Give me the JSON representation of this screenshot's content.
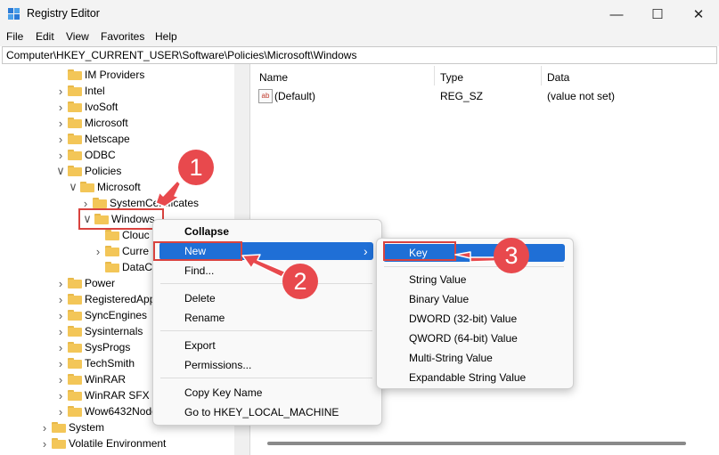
{
  "window": {
    "title": "Registry Editor"
  },
  "menu": [
    "File",
    "Edit",
    "View",
    "Favorites",
    "Help"
  ],
  "address": "Computer\\HKEY_CURRENT_USER\\Software\\Policies\\Microsoft\\Windows",
  "tree": [
    {
      "label": "IM Providers",
      "chev": ""
    },
    {
      "label": "Intel",
      "chev": ">"
    },
    {
      "label": "IvoSoft",
      "chev": ">"
    },
    {
      "label": "Microsoft",
      "chev": ">"
    },
    {
      "label": "Netscape",
      "chev": ">"
    },
    {
      "label": "ODBC",
      "chev": ">"
    },
    {
      "label": "Policies",
      "chev": "v"
    },
    {
      "label": "Microsoft",
      "chev": "v"
    },
    {
      "label": "SystemCertificates",
      "chev": ">"
    },
    {
      "label": "Windows",
      "chev": "v"
    },
    {
      "label": "Clouc",
      "chev": ""
    },
    {
      "label": "Curre",
      "chev": ">"
    },
    {
      "label": "DataC",
      "chev": ""
    },
    {
      "label": "Power",
      "chev": ">"
    },
    {
      "label": "RegisteredApp",
      "chev": ">"
    },
    {
      "label": "SyncEngines",
      "chev": ">"
    },
    {
      "label": "Sysinternals",
      "chev": ">"
    },
    {
      "label": "SysProgs",
      "chev": ">"
    },
    {
      "label": "TechSmith",
      "chev": ">"
    },
    {
      "label": "WinRAR",
      "chev": ">"
    },
    {
      "label": "WinRAR SFX",
      "chev": ">"
    },
    {
      "label": "Wow6432Node",
      "chev": ">"
    },
    {
      "label": "System",
      "chev": ">"
    },
    {
      "label": "Volatile Environment",
      "chev": ">"
    }
  ],
  "list": {
    "columns": [
      "Name",
      "Type",
      "Data"
    ],
    "rows": [
      {
        "name": "(Default)",
        "type": "REG_SZ",
        "data": "(value not set)"
      }
    ]
  },
  "context_menu": {
    "items": [
      "Collapse",
      "New",
      "Find...",
      "Delete",
      "Rename",
      "Export",
      "Permissions...",
      "Copy Key Name",
      "Go to HKEY_LOCAL_MACHINE"
    ],
    "submenu_arrow": "›"
  },
  "submenu": {
    "items": [
      "Key",
      "String Value",
      "Binary Value",
      "DWORD (32-bit) Value",
      "QWORD (64-bit) Value",
      "Multi-String Value",
      "Expandable String Value"
    ]
  },
  "callouts": [
    "1",
    "2",
    "3"
  ],
  "colors": {
    "highlight": "#1f6fd6",
    "callout": "#e8494d",
    "folder": "#f3c658"
  }
}
